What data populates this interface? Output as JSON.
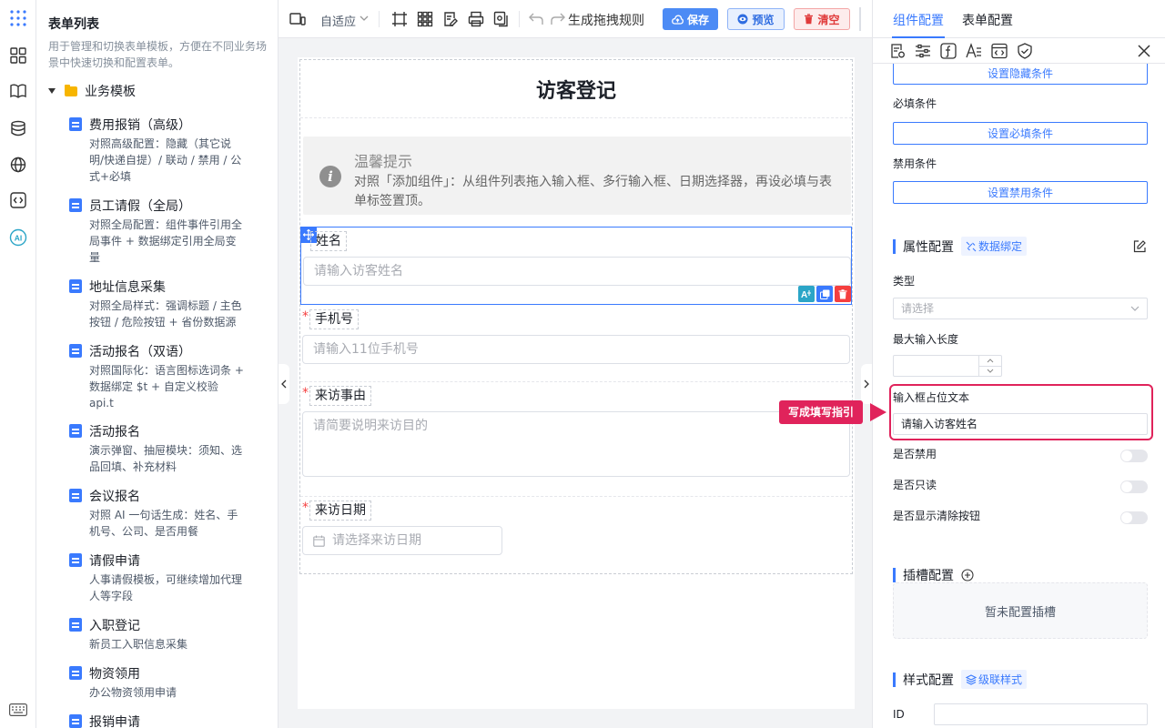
{
  "sidebar": {
    "title": "表单列表",
    "description": "用于管理和切换表单模板，方便在不同业务场景中快速切换和配置表单。",
    "folder": "业务模板",
    "templates": [
      {
        "name": "费用报销（高级）",
        "desc": "对照高级配置：隐藏（其它说明/快递自提）/ 联动 / 禁用 / 公式+必填"
      },
      {
        "name": "员工请假（全局）",
        "desc": "对照全局配置：组件事件引用全局事件 + 数据绑定引用全局变量"
      },
      {
        "name": "地址信息采集",
        "desc": "对照全局样式：强调标题 / 主色按钮 / 危险按钮 + 省份数据源"
      },
      {
        "name": "活动报名（双语）",
        "desc": "对照国际化：语言图标选词条 + 数据绑定 $t + 自定义校验 api.t"
      },
      {
        "name": "活动报名",
        "desc": "演示弹窗、抽屉模块：须知、选品回填、补充材料"
      },
      {
        "name": "会议报名",
        "desc": "对照 AI 一句话生成：姓名、手机号、公司、是否用餐"
      },
      {
        "name": "请假申请",
        "desc": "人事请假模板，可继续增加代理人等字段"
      },
      {
        "name": "入职登记",
        "desc": "新员工入职信息采集"
      },
      {
        "name": "物资领用",
        "desc": "办公物资领用申请"
      },
      {
        "name": "报销申请",
        "desc": ""
      }
    ]
  },
  "rail": {
    "icons": [
      "apps-grid-icon",
      "components-icon",
      "book-icon",
      "database-icon",
      "globe-icon",
      "code-icon",
      "ai-icon",
      "keyboard-icon"
    ],
    "ai_label": "AI"
  },
  "toolbar": {
    "layout_mode": "自适应",
    "drag_rules": "生成拖拽规则",
    "save": "保存",
    "preview": "预览",
    "clear": "清空"
  },
  "form": {
    "title": "访客登记",
    "tip_title": "温馨提示",
    "tip_text": "对照「添加组件」：从组件列表拖入输入框、多行输入框、日期选择器，再设必填与表单标签置顶。",
    "fields": [
      {
        "label": "姓名",
        "placeholder": "请输入访客姓名",
        "required": false
      },
      {
        "label": "手机号",
        "placeholder": "请输入11位手机号",
        "required": true
      },
      {
        "label": "来访事由",
        "placeholder": "请简要说明来访目的",
        "required": true
      },
      {
        "label": "来访日期",
        "placeholder": "请选择来访日期",
        "required": true
      }
    ],
    "required_mark": "*"
  },
  "panel": {
    "tab_component": "组件配置",
    "tab_form": "表单配置",
    "hidden_btn": "设置隐藏条件",
    "required_label": "必填条件",
    "required_btn": "设置必填条件",
    "disabled_label": "禁用条件",
    "disabled_btn": "设置禁用条件",
    "attr_title": "属性配置",
    "attr_tag": "数据绑定",
    "type_label": "类型",
    "type_placeholder": "请选择",
    "maxlen_label": "最大输入长度",
    "placeholder_label": "输入框占位文本",
    "placeholder_value": "请输入访客姓名",
    "disabled_switch": "是否禁用",
    "readonly_switch": "是否只读",
    "clearable_switch": "是否显示清除按钮",
    "slot_title": "插槽配置",
    "slot_empty": "暂未配置插槽",
    "style_title": "样式配置",
    "style_tag": "级联样式",
    "id_label": "ID"
  },
  "callout": {
    "text": "写成填写指引"
  },
  "colors": {
    "accent": "#3a7afe",
    "highlight": "#e0235b",
    "danger": "#f53f3f"
  }
}
